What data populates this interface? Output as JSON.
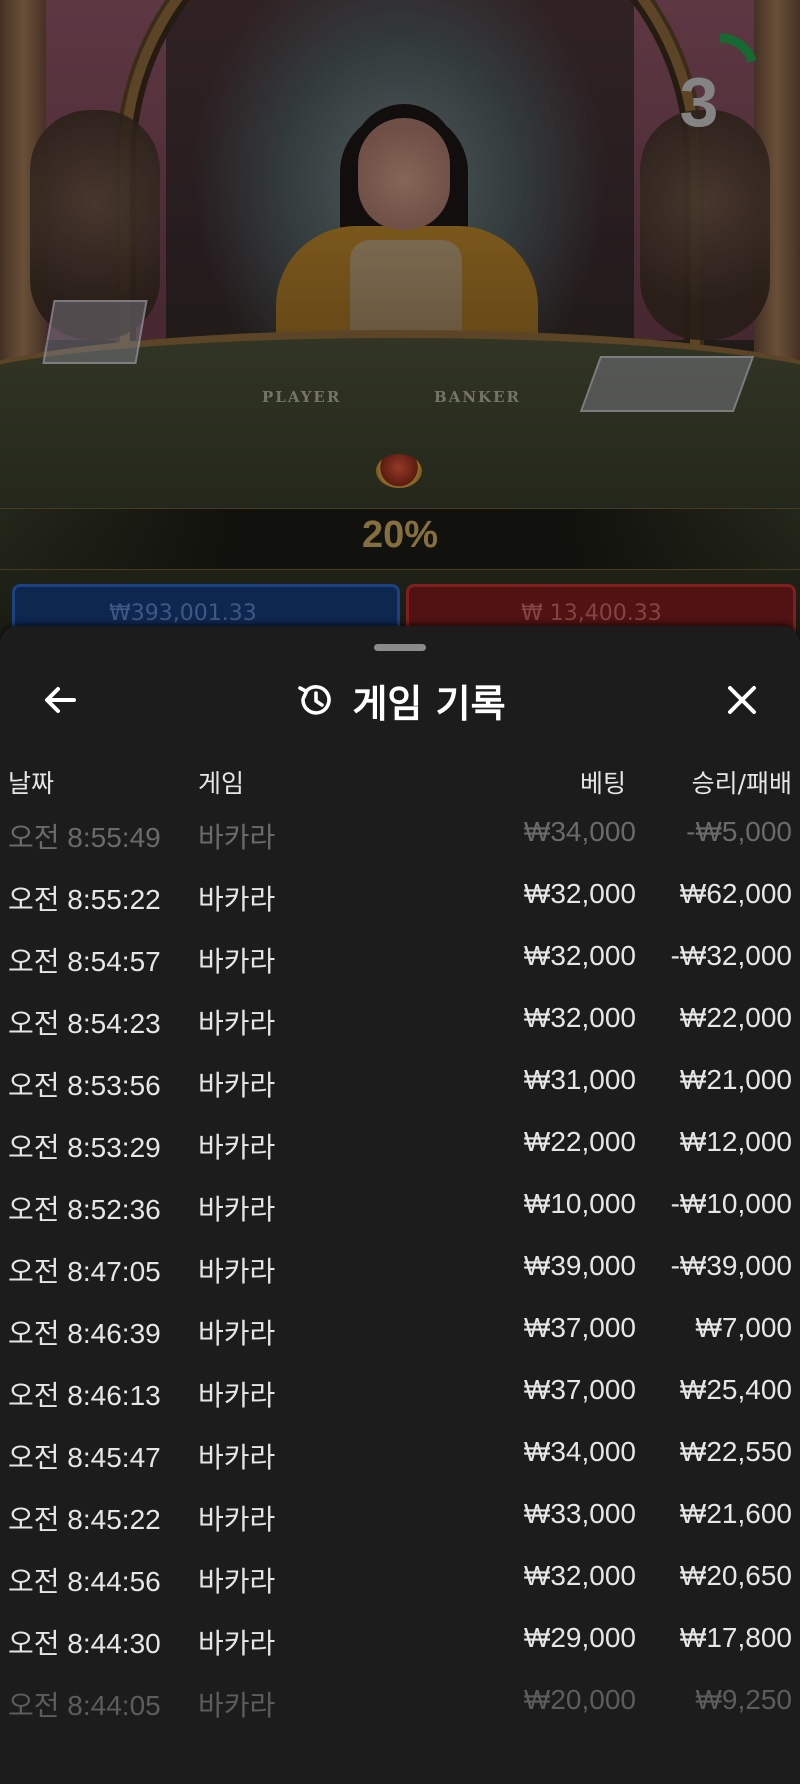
{
  "video": {
    "countdown": "3",
    "timer_fraction": 0.2,
    "felt_player": "PLAYER",
    "felt_banker": "BANKER",
    "percent": "20%",
    "player_total": "₩393,001.33",
    "banker_total": "₩ 13,400.33",
    "colors": {
      "player": "#163c78",
      "banker": "#7a1c1c",
      "timer": "#22a04a",
      "gold": "#caa860"
    }
  },
  "sheet": {
    "title": "게임 기록",
    "back_icon": "arrow-left-icon",
    "history_icon": "history-clock-icon",
    "close_icon": "close-x-icon",
    "columns": {
      "date": "날짜",
      "game": "게임",
      "bet": "베팅",
      "win_loss": "승리/패배"
    },
    "rows": [
      {
        "date": "오전 8:55:49",
        "game": "바카라",
        "bet": "₩34,000",
        "win_loss": "-₩5,000"
      },
      {
        "date": "오전 8:55:22",
        "game": "바카라",
        "bet": "₩32,000",
        "win_loss": "₩62,000"
      },
      {
        "date": "오전 8:54:57",
        "game": "바카라",
        "bet": "₩32,000",
        "win_loss": "-₩32,000"
      },
      {
        "date": "오전 8:54:23",
        "game": "바카라",
        "bet": "₩32,000",
        "win_loss": "₩22,000"
      },
      {
        "date": "오전 8:53:56",
        "game": "바카라",
        "bet": "₩31,000",
        "win_loss": "₩21,000"
      },
      {
        "date": "오전 8:53:29",
        "game": "바카라",
        "bet": "₩22,000",
        "win_loss": "₩12,000"
      },
      {
        "date": "오전 8:52:36",
        "game": "바카라",
        "bet": "₩10,000",
        "win_loss": "-₩10,000"
      },
      {
        "date": "오전 8:47:05",
        "game": "바카라",
        "bet": "₩39,000",
        "win_loss": "-₩39,000"
      },
      {
        "date": "오전 8:46:39",
        "game": "바카라",
        "bet": "₩37,000",
        "win_loss": "₩7,000"
      },
      {
        "date": "오전 8:46:13",
        "game": "바카라",
        "bet": "₩37,000",
        "win_loss": "₩25,400"
      },
      {
        "date": "오전 8:45:47",
        "game": "바카라",
        "bet": "₩34,000",
        "win_loss": "₩22,550"
      },
      {
        "date": "오전 8:45:22",
        "game": "바카라",
        "bet": "₩33,000",
        "win_loss": "₩21,600"
      },
      {
        "date": "오전 8:44:56",
        "game": "바카라",
        "bet": "₩32,000",
        "win_loss": "₩20,650"
      },
      {
        "date": "오전 8:44:30",
        "game": "바카라",
        "bet": "₩29,000",
        "win_loss": "₩17,800"
      },
      {
        "date": "오전 8:44:05",
        "game": "바카라",
        "bet": "₩20,000",
        "win_loss": "₩9,250"
      }
    ]
  }
}
